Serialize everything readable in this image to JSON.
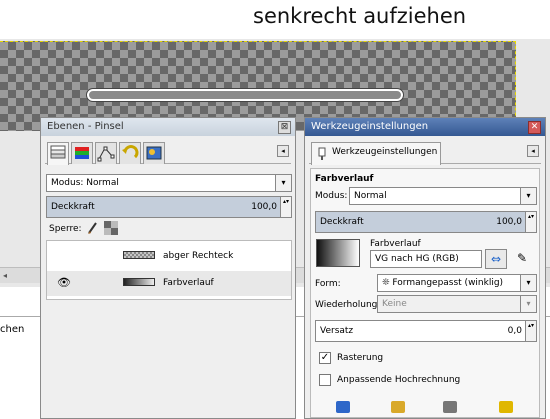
{
  "heading": "senkrecht aufziehen",
  "canvas": {
    "left_cut_text": "chen"
  },
  "layers_panel": {
    "title": "Ebenen - Pinsel",
    "close_glyph": "⊠",
    "tab_menu_glyph": "◂",
    "mode_label": "Modus: Normal",
    "opacity_label": "Deckkraft",
    "opacity_value": "100,0",
    "lock_label": "Sperre:",
    "layers": [
      {
        "name": "abger Rechteck",
        "visible": false
      },
      {
        "name": "Farbverlauf",
        "visible": true
      }
    ]
  },
  "tool_panel": {
    "title": "Werkzeugeinstellungen",
    "close_glyph": "✕",
    "tab_label": "Werkzeugeinstellungen",
    "tab_menu_glyph": "◂",
    "tool_name": "Farbverlauf",
    "mode_label": "Modus:",
    "mode_value": "Normal",
    "opacity_label": "Deckkraft",
    "opacity_value": "100,0",
    "gradient_label": "Farbverlauf",
    "gradient_value": "VG nach HG (RGB)",
    "form_label": "Form:",
    "form_value": "Formangepasst (winklig)",
    "repeat_label": "Wiederholung:",
    "repeat_value": "Keine",
    "offset_label": "Versatz",
    "offset_value": "0,0",
    "dithering_label": "Rasterung",
    "dithering_checked": true,
    "supersampling_label": "Anpassende Hochrechnung",
    "supersampling_checked": false
  },
  "icons": {
    "dropdown": "▾",
    "spin": "▴▾",
    "eye": "👁",
    "reverse": "⇔",
    "edit": "✎",
    "check": "✓"
  }
}
